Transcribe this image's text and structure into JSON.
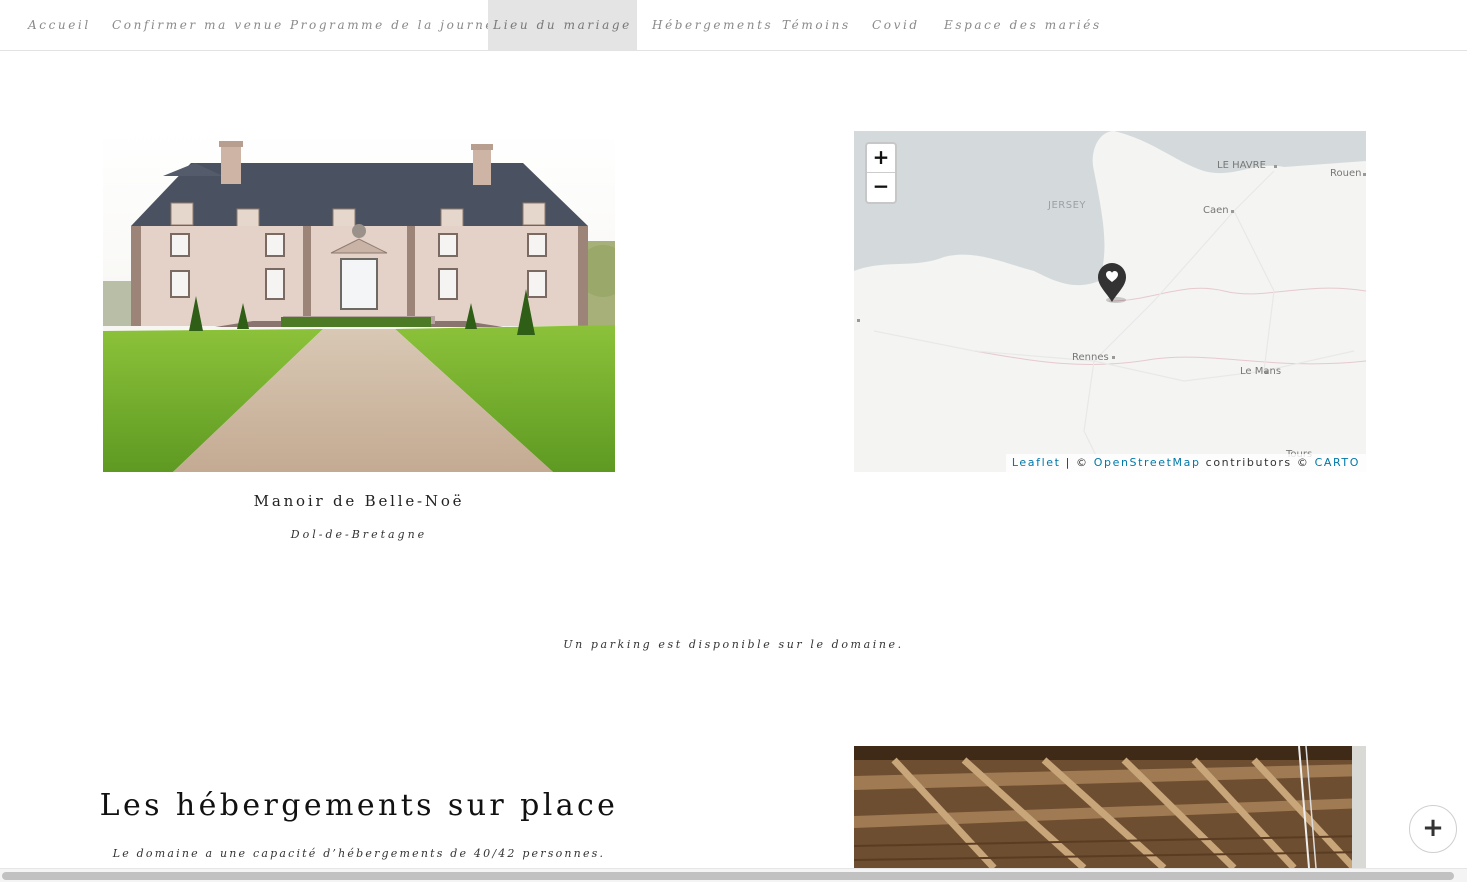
{
  "nav": {
    "items": [
      {
        "label": "Accueil"
      },
      {
        "label": "Confirmer ma venue"
      },
      {
        "label": "Programme de la journée"
      },
      {
        "label": "Lieu du mariage"
      },
      {
        "label": "Hébergements"
      },
      {
        "label": "Témoins"
      },
      {
        "label": "Covid"
      },
      {
        "label": "Espace des mariés"
      }
    ],
    "active": "Lieu du mariage"
  },
  "venue": {
    "name": "Manoir de Belle-Noë",
    "town": "Dol-de-Bretagne"
  },
  "map": {
    "zoom_in": "+",
    "zoom_out": "−",
    "labels": {
      "le_havre": "LE HAVRE",
      "rouen": "Rouen",
      "caen": "Caen",
      "jersey": "JERSEY",
      "rennes": "Rennes",
      "le_mans": "Le Mans",
      "tours": "Tours"
    },
    "attribution": {
      "leaflet": "Leaflet",
      "sep": " | © ",
      "osm": "OpenStreetMap",
      "contrib": " contributors © ",
      "carto": "CARTO"
    },
    "marker_icon": "heart-map-marker-icon"
  },
  "parking_note": "Un parking est disponible sur le domaine.",
  "accommodation": {
    "title": "Les hébergements sur place",
    "capacity": "Le domaine a une capacité d’hébergements de 40/42 personnes."
  },
  "fab": {
    "icon": "plus-icon",
    "label": "+"
  },
  "colors": {
    "nav_active_bg": "#e4e4e4",
    "nav_text": "#8a8a8a",
    "link": "#0078a8",
    "sea": "#d4dadc",
    "land": "#f4f4f2",
    "marker": "#333333"
  }
}
